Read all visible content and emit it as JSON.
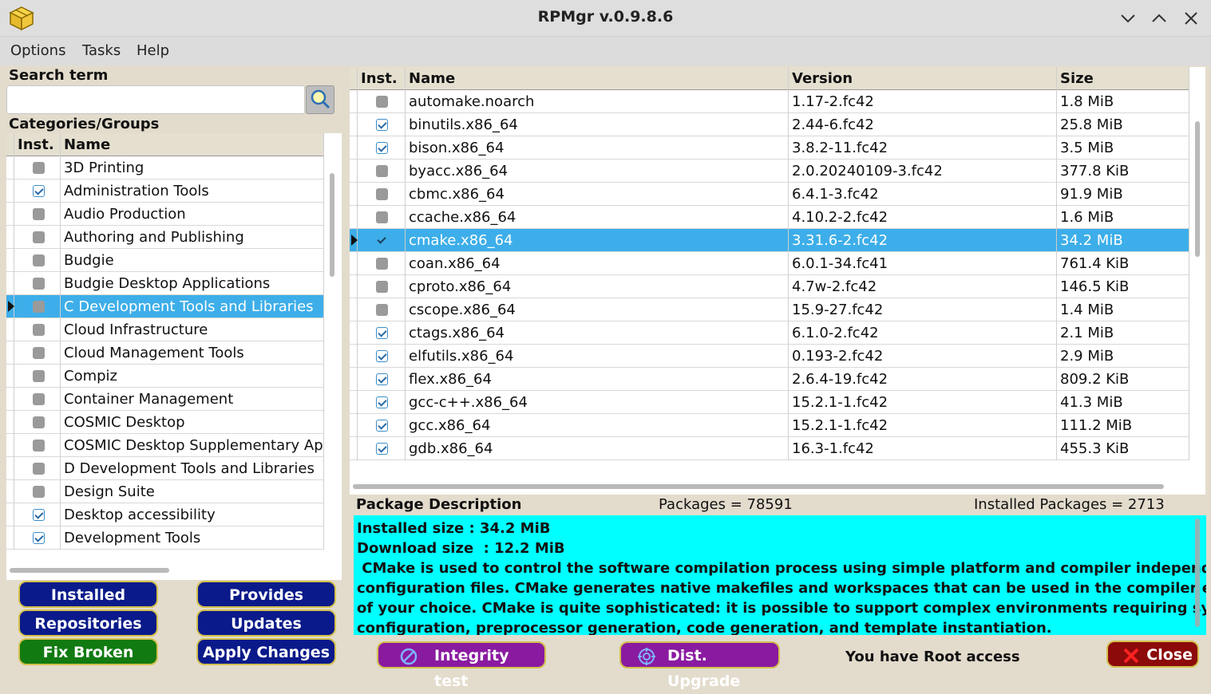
{
  "window": {
    "title": "RPMgr v.0.9.8.6"
  },
  "menu": [
    "Options",
    "Tasks",
    "Help"
  ],
  "left": {
    "search_label": "Search term",
    "search_placeholder": "",
    "categories_label": "Categories/Groups",
    "columns": [
      "Inst.",
      "Name"
    ],
    "rows": [
      {
        "name": "3D Printing",
        "inst": false
      },
      {
        "name": "Administration Tools",
        "inst": true
      },
      {
        "name": "Audio Production",
        "inst": false
      },
      {
        "name": "Authoring and Publishing",
        "inst": false
      },
      {
        "name": "Budgie",
        "inst": false
      },
      {
        "name": "Budgie Desktop Applications",
        "inst": false
      },
      {
        "name": "C Development Tools and Libraries",
        "inst": false,
        "selected": true
      },
      {
        "name": "Cloud Infrastructure",
        "inst": false
      },
      {
        "name": "Cloud Management Tools",
        "inst": false
      },
      {
        "name": "Compiz",
        "inst": false
      },
      {
        "name": "Container Management",
        "inst": false
      },
      {
        "name": "COSMIC Desktop",
        "inst": false
      },
      {
        "name": "COSMIC Desktop Supplementary App",
        "inst": false
      },
      {
        "name": "D Development Tools and Libraries",
        "inst": false
      },
      {
        "name": "Design Suite",
        "inst": false
      },
      {
        "name": "Desktop accessibility",
        "inst": true
      },
      {
        "name": "Development Tools",
        "inst": true
      }
    ]
  },
  "packages": {
    "columns": [
      "Inst.",
      "Name",
      "Version",
      "Size"
    ],
    "rows": [
      {
        "name": "automake.noarch",
        "version": "1.17-2.fc42",
        "size": "1.8 MiB",
        "inst": false
      },
      {
        "name": "binutils.x86_64",
        "version": "2.44-6.fc42",
        "size": "25.8 MiB",
        "inst": true
      },
      {
        "name": "bison.x86_64",
        "version": "3.8.2-11.fc42",
        "size": "3.5 MiB",
        "inst": true
      },
      {
        "name": "byacc.x86_64",
        "version": "2.0.20240109-3.fc42",
        "size": "377.8 KiB",
        "inst": false
      },
      {
        "name": "cbmc.x86_64",
        "version": "6.4.1-3.fc42",
        "size": "91.9 MiB",
        "inst": false
      },
      {
        "name": "ccache.x86_64",
        "version": "4.10.2-2.fc42",
        "size": "1.6 MiB",
        "inst": false
      },
      {
        "name": "cmake.x86_64",
        "version": "3.31.6-2.fc42",
        "size": "34.2 MiB",
        "inst": true,
        "selected": true
      },
      {
        "name": "coan.x86_64",
        "version": "6.0.1-34.fc41",
        "size": "761.4 KiB",
        "inst": false
      },
      {
        "name": "cproto.x86_64",
        "version": "4.7w-2.fc42",
        "size": "146.5 KiB",
        "inst": false
      },
      {
        "name": "cscope.x86_64",
        "version": "15.9-27.fc42",
        "size": "1.4 MiB",
        "inst": false
      },
      {
        "name": "ctags.x86_64",
        "version": "6.1.0-2.fc42",
        "size": "2.1 MiB",
        "inst": true
      },
      {
        "name": "elfutils.x86_64",
        "version": "0.193-2.fc42",
        "size": "2.9 MiB",
        "inst": true
      },
      {
        "name": "flex.x86_64",
        "version": "2.6.4-19.fc42",
        "size": "809.2 KiB",
        "inst": true
      },
      {
        "name": "gcc-c++.x86_64",
        "version": "15.2.1-1.fc42",
        "size": "41.3 MiB",
        "inst": true
      },
      {
        "name": "gcc.x86_64",
        "version": "15.2.1-1.fc42",
        "size": "111.2 MiB",
        "inst": true
      },
      {
        "name": "gdb.x86_64",
        "version": "16.3-1.fc42",
        "size": "455.3 KiB",
        "inst": true
      }
    ]
  },
  "status": {
    "desc_label": "Package Description",
    "packages_count": "Packages = 78591",
    "installed_count": "Installed Packages = 2713"
  },
  "description": [
    "Installed size : 34.2 MiB",
    "Download size  : 12.2 MiB",
    " CMake is used to control the software compilation process using simple platform and compiler independent",
    "configuration files. CMake generates native makefiles and workspaces that can be used in the compiler environment",
    "of your choice. CMake is quite sophisticated: it is possible to support complex environments requiring system",
    "configuration, preprocessor generation, code generation, and template instantiation."
  ],
  "buttons": {
    "installed": "Installed",
    "provides": "Provides",
    "repositories": "Repositories",
    "updates": "Updates",
    "fix_broken": "Fix Broken",
    "apply_changes": "Apply Changes",
    "integrity": "Integrity test",
    "dist_upgrade": "Dist. Upgrade",
    "close": "Close"
  },
  "root_msg": "You have Root access",
  "icons": {
    "app": "package-box-icon",
    "search": "magnifier-icon",
    "integrity": "refresh-icon",
    "dist_upgrade": "target-icon",
    "close": "x-icon"
  },
  "colors": {
    "selection": "#3daee9",
    "description_bg": "#00ffff",
    "button_navy": "#0a1a8a",
    "button_green": "#117a11",
    "button_purple": "#8a1aa0",
    "button_red": "#8c0a0a"
  }
}
